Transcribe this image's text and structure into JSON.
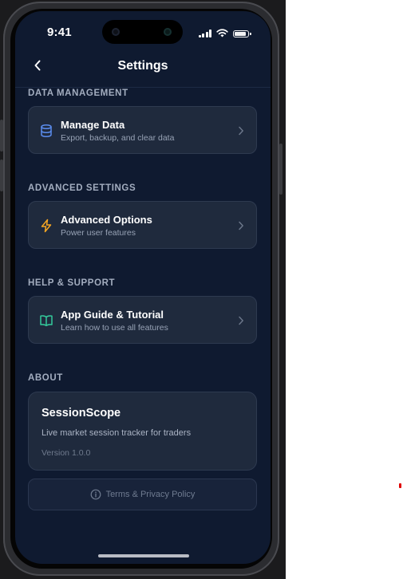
{
  "status_bar": {
    "time": "9:41"
  },
  "nav": {
    "title": "Settings",
    "back_icon": "chevron-left-icon"
  },
  "sections": [
    {
      "title": "DATA MANAGEMENT",
      "item": {
        "label": "Manage Data",
        "description": "Export, backup, and clear data",
        "icon": "database-icon",
        "icon_color": "#5b8def"
      }
    },
    {
      "title": "ADVANCED SETTINGS",
      "item": {
        "label": "Advanced Options",
        "description": "Power user features",
        "icon": "lightning-icon",
        "icon_color": "#f5a623"
      }
    },
    {
      "title": "HELP & SUPPORT",
      "item": {
        "label": "App Guide & Tutorial",
        "description": "Learn how to use all features",
        "icon": "book-icon",
        "icon_color": "#34c99b"
      }
    }
  ],
  "about": {
    "title": "ABOUT",
    "app_name": "SessionScope",
    "tagline": "Live market session tracker for traders",
    "version": "Version 1.0.0"
  },
  "terms": {
    "label": "Terms & Privacy Policy",
    "icon": "info-icon"
  },
  "colors": {
    "background": "#0f1a30",
    "card": "#1f2a3d",
    "text_primary": "#ffffff",
    "text_secondary": "#98a3b6"
  }
}
